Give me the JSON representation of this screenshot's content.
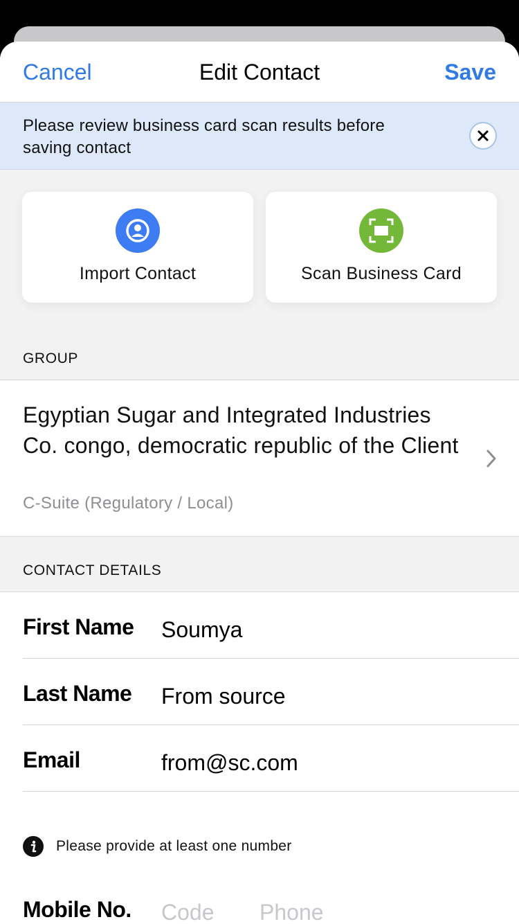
{
  "nav": {
    "cancel_label": "Cancel",
    "title": "Edit Contact",
    "save_label": "Save"
  },
  "banner": {
    "message": "Please review business card scan results before saving contact",
    "close_icon": "close-icon"
  },
  "actions": [
    {
      "label": "Import Contact",
      "icon": "person-icon",
      "color": "#3d7cf2"
    },
    {
      "label": "Scan Business Card",
      "icon": "scan-icon",
      "color": "#74b83a"
    }
  ],
  "group": {
    "header": "GROUP",
    "name": "Egyptian Sugar and Integrated Industries Co. congo, democratic republic of the Client",
    "subtitle": "C-Suite (Regulatory / Local)"
  },
  "contact_details": {
    "header": "CONTACT DETAILS",
    "fields": [
      {
        "label": "First Name",
        "value": "Soumya"
      },
      {
        "label": "Last Name",
        "value": "From source"
      },
      {
        "label": "Email",
        "value": "from@sc.com"
      }
    ],
    "notice": "Please provide at least one number",
    "mobile": {
      "label": "Mobile No.",
      "code_placeholder": "Code",
      "phone_placeholder": "Phone"
    }
  },
  "colors": {
    "accent": "#2f7ae5",
    "banner_bg": "#dde9f8"
  }
}
